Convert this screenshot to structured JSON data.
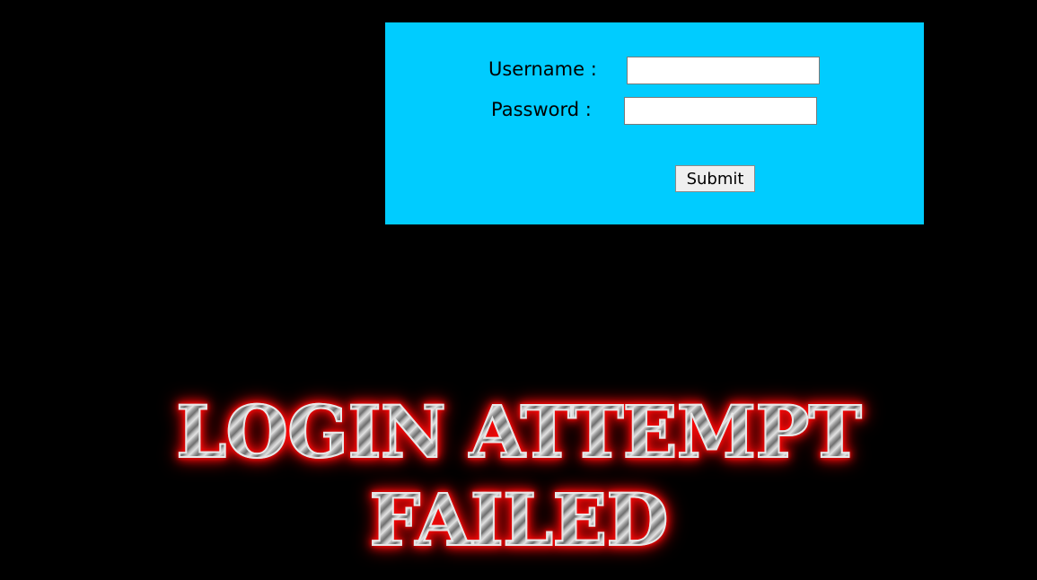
{
  "login_form": {
    "username_label": "Username :",
    "username_value": "",
    "password_label": "Password :",
    "password_value": "",
    "submit_label": "Submit",
    "panel_color": "#00ccff"
  },
  "banner": {
    "line1": "LOGIN ATTEMPT",
    "line2": "FAILED",
    "glow_color": "#ff0000"
  }
}
